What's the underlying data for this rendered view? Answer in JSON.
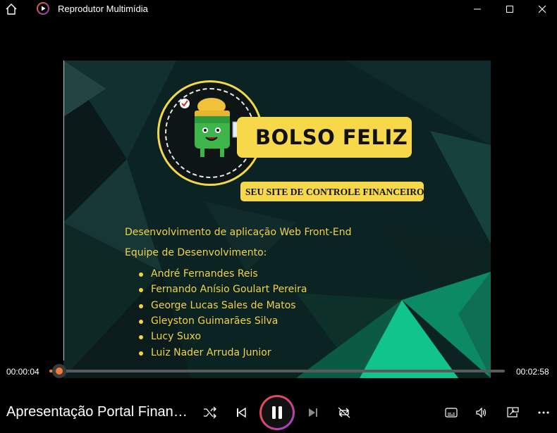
{
  "window": {
    "title": "Reprodutor Multimídia",
    "icons": [
      "home-icon",
      "app-icon",
      "minimize-icon",
      "maximize-icon",
      "close-icon"
    ]
  },
  "slide": {
    "logo_text": "BOLSO FELIZ",
    "slogan": "SEU SITE DE CONTROLE FINANCEIRO",
    "line1": "Desenvolvimento de aplicação Web Front-End",
    "line2": "Equipe de Desenvolvimento:",
    "team": [
      "André Fernandes Reis",
      "Fernando Anísio Goulart Pereira",
      "George Lucas Sales de Matos",
      "Gleyston Guimarães Silva",
      "Lucy Suxo",
      "Luiz Nader Arruda Junior"
    ],
    "text_color": "#f3d24a"
  },
  "playback": {
    "current_time": "00:00:04",
    "total_time": "00:02:58",
    "progress_fraction": 0.022,
    "accent": "#f27b3a"
  },
  "media": {
    "title": "Apresentação Portal Financeiro"
  },
  "controls": {
    "icons": [
      "shuffle-icon",
      "previous-icon",
      "pause-icon",
      "next-icon",
      "repeat-icon",
      "subtitles-icon",
      "volume-icon",
      "miniplayer-icon",
      "more-icon"
    ]
  }
}
